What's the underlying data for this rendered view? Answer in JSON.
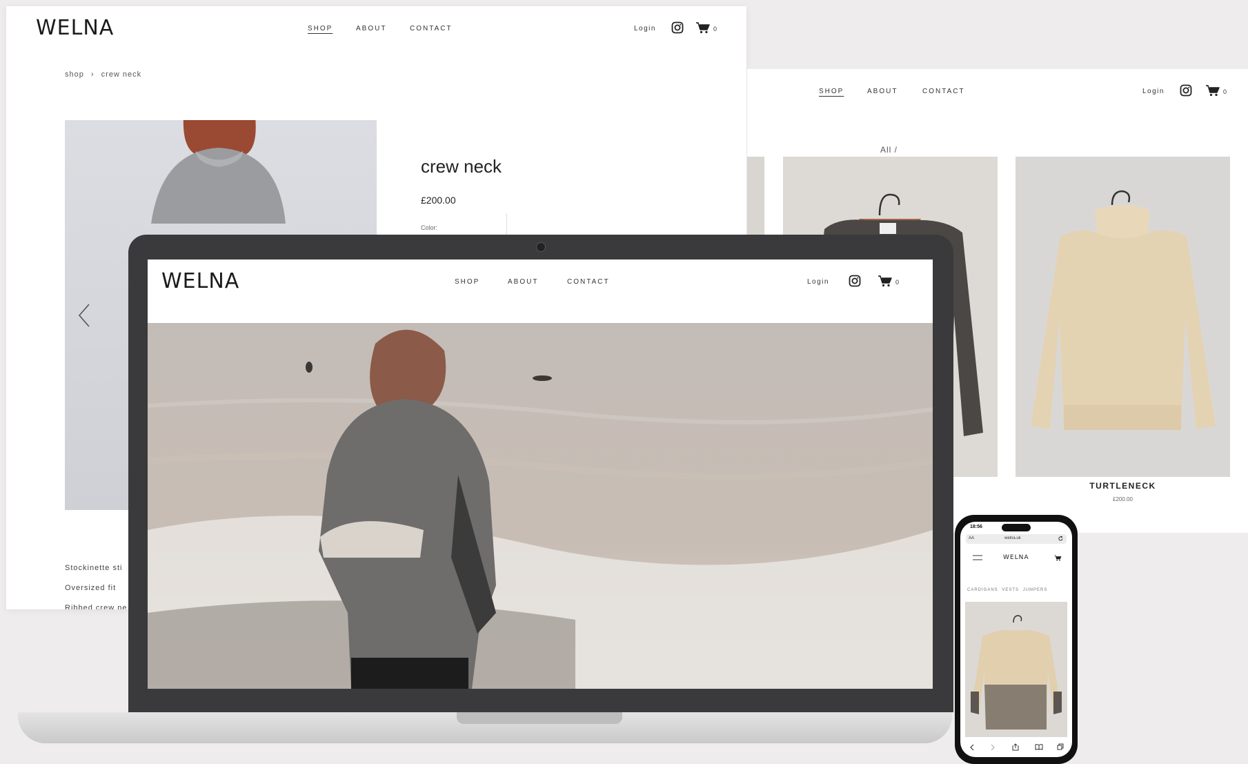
{
  "brand": "WELNA",
  "nav": {
    "shop": "SHOP",
    "about": "ABOUT",
    "contact": "CONTACT"
  },
  "login": "Login",
  "cart_count": "0",
  "product_page": {
    "breadcrumb": {
      "root": "shop",
      "separator": "›",
      "current": "crew neck"
    },
    "title": "crew neck",
    "price": "£200.00",
    "color_label": "Color:",
    "features": [
      "Stockinette sti",
      "Oversized fit",
      "Ribbed crew ne"
    ]
  },
  "catalog_page": {
    "filter": "All /",
    "items": [
      {
        "name": "TURTLENECK",
        "price": "£200.00"
      }
    ]
  },
  "phone": {
    "time": "18:56",
    "aa": "AA",
    "url": "welna.uk",
    "brand": "WELNA",
    "categories": [
      "CARDIGANS",
      "VESTS",
      "JUMPERS"
    ]
  },
  "colors": {
    "page_bg": "#eeecec",
    "laptop_bezel": "#3a3a3c",
    "text_dark": "#1b1b1b"
  },
  "icons": [
    "instagram-icon",
    "cart-icon",
    "chevron-left-icon",
    "hamburger-icon",
    "reload-icon",
    "share-icon",
    "book-icon",
    "tabs-icon"
  ]
}
